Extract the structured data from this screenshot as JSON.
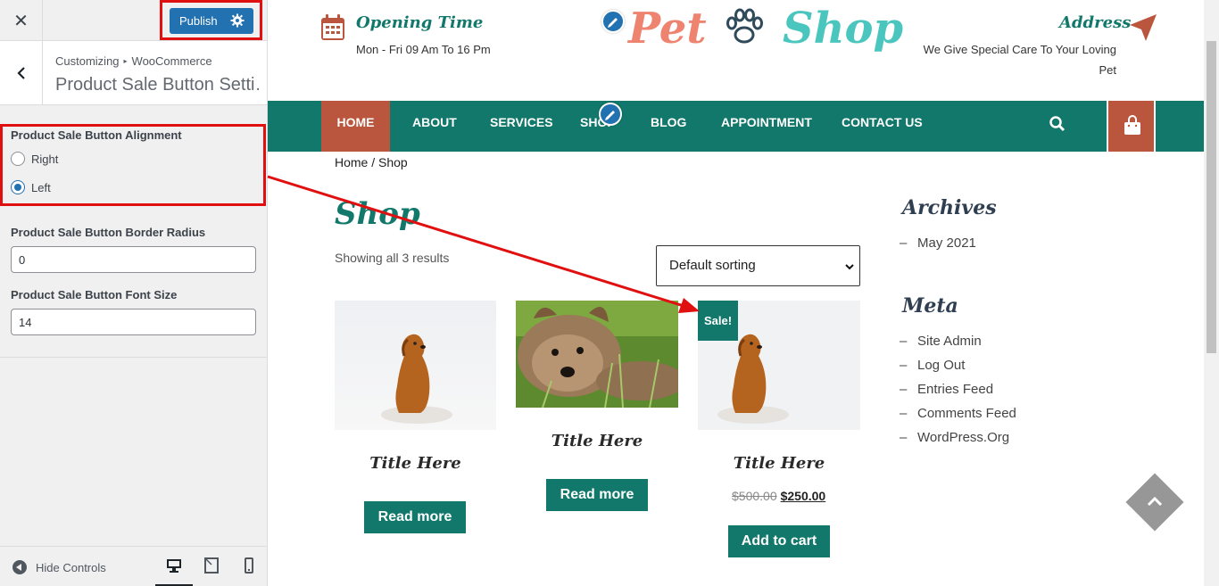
{
  "sidebar": {
    "publish_label": "Publish",
    "breadcrumb": {
      "root": "Customizing",
      "section": "WooCommerce"
    },
    "section_title": "Product Sale Button Setti…",
    "alignment": {
      "label": "Product Sale Button Alignment",
      "options": [
        {
          "label": "Right",
          "checked": false
        },
        {
          "label": "Left",
          "checked": true
        }
      ]
    },
    "border_radius": {
      "label": "Product Sale Button Border Radius",
      "value": "0"
    },
    "font_size": {
      "label": "Product Sale Button Font Size",
      "value": "14"
    },
    "footer": {
      "hide_controls": "Hide Controls"
    }
  },
  "site": {
    "opening": {
      "title": "Opening Time",
      "text": "Mon - Fri 09 Am To 16 Pm"
    },
    "logo": {
      "part1": "Pet",
      "part2": "Shop"
    },
    "address": {
      "title": "Address",
      "line1": "We Give Special Care To Your Loving",
      "line2": "Pet"
    },
    "nav": [
      "HOME",
      "ABOUT",
      "SERVICES",
      "SHOP",
      "BLOG",
      "APPOINTMENT",
      "CONTACT US"
    ],
    "breadcrumb": "Home / Shop",
    "page_title": "Shop",
    "results": "Showing all 3 results",
    "sort": "Default sorting",
    "products": [
      {
        "title": "Title Here",
        "button": "Read more"
      },
      {
        "title": "Title Here",
        "button": "Read more"
      },
      {
        "title": "Title Here",
        "button": "Add to cart",
        "sale_badge": "Sale!",
        "old_price": "$500.00",
        "new_price": "$250.00"
      }
    ],
    "widgets": {
      "archives": {
        "title": "Archives",
        "items": [
          "May 2021"
        ]
      },
      "meta": {
        "title": "Meta",
        "items": [
          "Site Admin",
          "Log Out",
          "Entries Feed",
          "Comments Feed",
          "WordPress.Org"
        ]
      }
    }
  },
  "colors": {
    "teal": "#12786b",
    "terracotta": "#b9563d",
    "wp_blue": "#2271b1",
    "annotation_red": "#e01010"
  }
}
